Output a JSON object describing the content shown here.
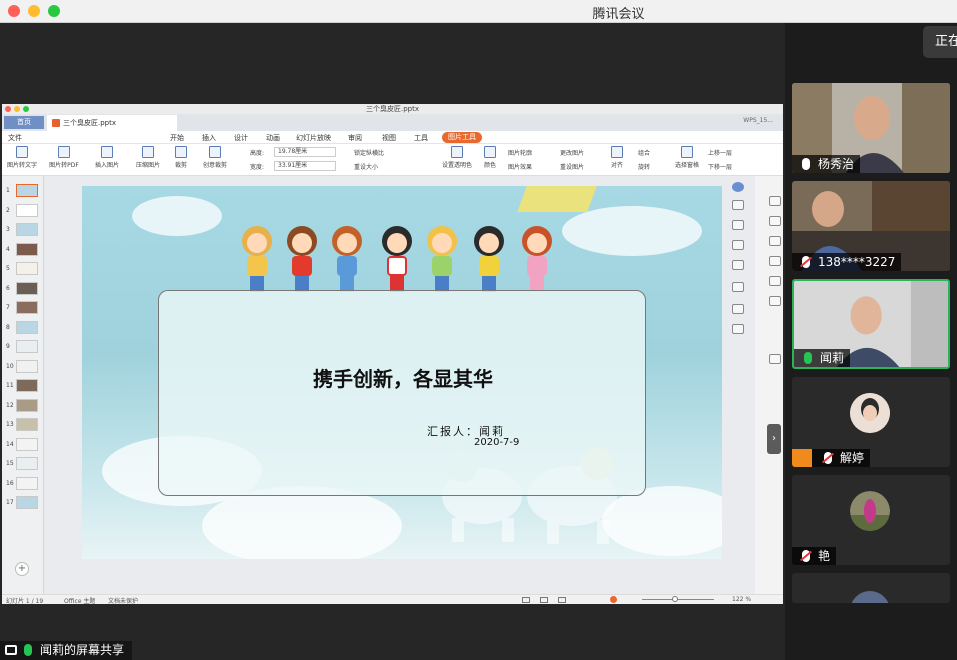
{
  "app": {
    "title": "腾讯会议",
    "status_text": "正在"
  },
  "wps": {
    "window_title": "三个臭皮匠.pptx",
    "home_tab": "首页",
    "file_tab": "三个臭皮匠.pptx",
    "account": "WPS_15...",
    "menu": [
      "文件",
      "开始",
      "插入",
      "设计",
      "动画",
      "幻灯片放映",
      "审阅",
      "视图",
      "工具",
      "图片工具"
    ],
    "active_menu": "图片工具",
    "ribbon": {
      "pic_to_text": "图片转文字",
      "pic_to_pdf": "图片转PDF",
      "insert_pic": "插入图片",
      "compress_pic": "压缩图片",
      "crop": "裁剪",
      "create_combine": "创意裁剪",
      "height_label": "高度:",
      "height_value": "19.78厘米",
      "width_label": "宽度:",
      "width_value": "33.91厘米",
      "lock_ratio": "锁定纵横比",
      "reset_size": "重设大小",
      "set_transparent": "设置透明色",
      "color": "颜色",
      "pic_outline": "图片轮廓",
      "pic_effect": "图片效果",
      "change_pic": "更改图片",
      "reset_pic": "重设图片",
      "align": "对齐",
      "combine": "组合",
      "rotate": "旋转",
      "select_pane": "选择窗格",
      "up": "上移一层",
      "down": "下移一层"
    },
    "thumbnails": [
      "1",
      "2",
      "3",
      "4",
      "5",
      "6",
      "7",
      "8",
      "9",
      "10",
      "11",
      "12",
      "13",
      "14",
      "15",
      "16",
      "17"
    ],
    "add_slide": "+",
    "slide": {
      "title": "携手创新，各显其华",
      "reporter": "汇报人：闻莉",
      "date": "2020-7-9"
    },
    "status": {
      "slide_index": "幻灯片 1 / 19",
      "theme": "Office 主题",
      "protect": "文档未保护",
      "zoom": "122 %"
    }
  },
  "share_bar": {
    "label": "闻莉的屏幕共享"
  },
  "participants": [
    {
      "name": "杨秀治",
      "mic": "live-white",
      "type": "video"
    },
    {
      "name": "138****3227",
      "mic": "muted",
      "type": "video"
    },
    {
      "name": "闻莉",
      "mic": "live",
      "type": "video",
      "active": true
    },
    {
      "name": "解婷",
      "mic": "muted",
      "type": "avatar",
      "host": true
    },
    {
      "name": "艳",
      "mic": "muted",
      "type": "avatar"
    }
  ],
  "colors": {
    "accent_orange": "#e8692e",
    "speaking_green": "#2bb35a",
    "muted_red": "#e5383b"
  }
}
